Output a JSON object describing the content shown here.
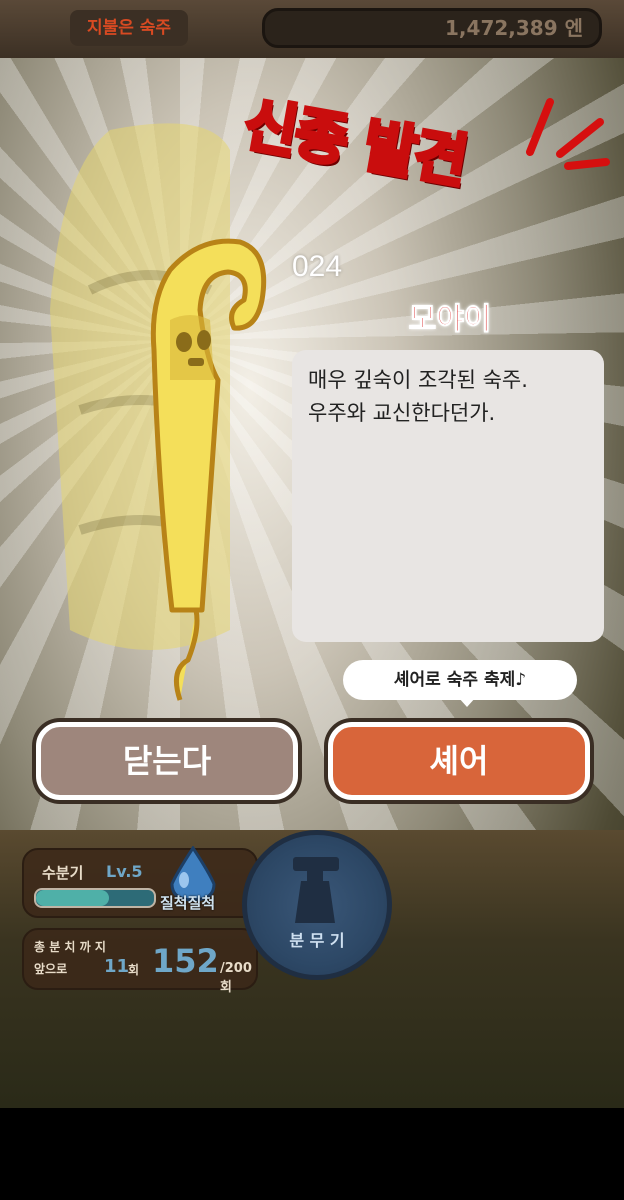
{
  "header": {
    "screen_title": "지불은 숙주",
    "money": "1,472,389 엔"
  },
  "banner": {
    "headline": "신종 발견"
  },
  "creature": {
    "number": "024",
    "name": "모야이",
    "description_line1": "매우 깊숙이 조각된 숙주.",
    "description_line2": "우주와 교신한다던가."
  },
  "share_hint": "셰어로 숙주 축제♪",
  "buttons": {
    "close": "닫는다",
    "share": "셰어"
  },
  "water": {
    "label": "수분기",
    "level": "Lv.5",
    "status": "질척질척",
    "fill_fraction": 0.62
  },
  "harvest": {
    "line1": "총 분 치 까 지",
    "line2": "앞으로",
    "remaining": "11",
    "remaining_unit": "회",
    "current": "152",
    "max": "/200회"
  },
  "spray": {
    "label": "분 무 기"
  },
  "colors": {
    "accent_red": "#d61515",
    "share_orange": "#d8653a",
    "close_mauve": "#9e867c"
  }
}
